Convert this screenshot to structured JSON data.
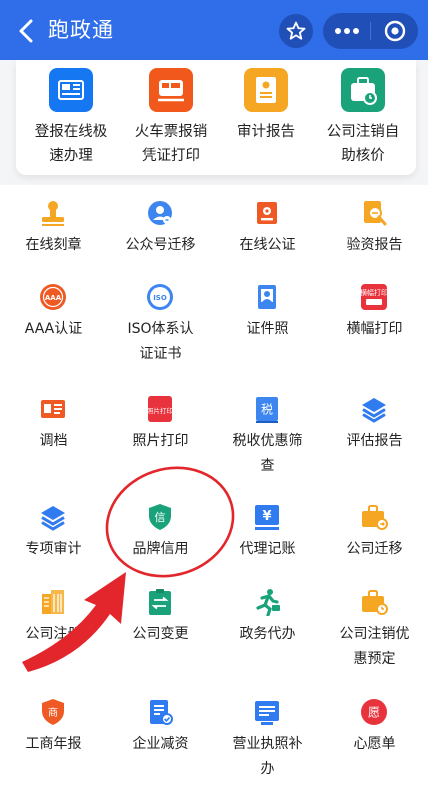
{
  "app": {
    "title": "跑政通"
  },
  "header": {
    "back_glyph": "<",
    "buttons": [
      "star-icon",
      "more-icon",
      "close-target-icon"
    ]
  },
  "hero": [
    {
      "label": "登报在线极速办理",
      "lines": [
        "登报在线极",
        "速办理"
      ],
      "icon": "newspaper-icon",
      "color": "#1677f2"
    },
    {
      "label": "火车票报销凭证打印",
      "lines": [
        "火车票报销",
        "凭证打印"
      ],
      "icon": "train-icon",
      "color": "#f1581b"
    },
    {
      "label": "审计报告",
      "lines": [
        "审计报告"
      ],
      "icon": "report-icon",
      "color": "#f5a623"
    },
    {
      "label": "公司注销自助核价",
      "lines": [
        "公司注销自",
        "助核价"
      ],
      "icon": "briefcase-icon",
      "color": "#1aa37a"
    }
  ],
  "grid": [
    {
      "lines": [
        "在线刻章"
      ],
      "icon": "stamp-icon",
      "color": "#f5a623"
    },
    {
      "lines": [
        "公众号迁移"
      ],
      "icon": "person-circle-icon",
      "color": "#3d86f0"
    },
    {
      "lines": [
        "在线公证"
      ],
      "icon": "notary-icon",
      "color": "#ef5a24"
    },
    {
      "lines": [
        "验资报告"
      ],
      "icon": "search-doc-icon",
      "color": "#f5a623"
    },
    {
      "lines": [
        "AAA认证"
      ],
      "icon": "aaa-badge-icon",
      "color": "#ef5a24"
    },
    {
      "lines": [
        "ISO体系认",
        "证证书"
      ],
      "icon": "iso-badge-icon",
      "color": "#3d86f0"
    },
    {
      "lines": [
        "证件照"
      ],
      "icon": "id-photo-icon",
      "color": "#3d86f0"
    },
    {
      "lines": [
        "横幅打印"
      ],
      "icon": "banner-icon",
      "color": "#e8323c"
    },
    {
      "lines": [
        "调档"
      ],
      "icon": "id-card-icon",
      "color": "#ef5a24"
    },
    {
      "lines": [
        "照片打印"
      ],
      "icon": "photo-print-icon",
      "color": "#e8323c"
    },
    {
      "lines": [
        "税收优惠筛",
        "查"
      ],
      "icon": "tax-icon",
      "color": "#3d86f0"
    },
    {
      "lines": [
        "评估报告"
      ],
      "icon": "layers-icon",
      "color": "#2f7bef"
    },
    {
      "lines": [
        "专项审计"
      ],
      "icon": "layers-icon",
      "color": "#2f7bef"
    },
    {
      "lines": [
        "品牌信用"
      ],
      "icon": "shield-icon",
      "color": "#1aa37a"
    },
    {
      "lines": [
        "代理记账"
      ],
      "icon": "yen-icon",
      "color": "#2f7bef"
    },
    {
      "lines": [
        "公司迁移"
      ],
      "icon": "briefcase-move-icon",
      "color": "#f5a623"
    },
    {
      "lines": [
        "公司注册"
      ],
      "icon": "building-icon",
      "color": "#f5a623"
    },
    {
      "lines": [
        "公司变更"
      ],
      "icon": "clipboard-swap-icon",
      "color": "#1aa37a"
    },
    {
      "lines": [
        "政务代办"
      ],
      "icon": "runner-icon",
      "color": "#1aa37a"
    },
    {
      "lines": [
        "公司注销优",
        "惠预定"
      ],
      "icon": "briefcase-icon",
      "color": "#f5a623"
    },
    {
      "lines": [
        "工商年报"
      ],
      "icon": "shop-badge-icon",
      "color": "#ef5a24"
    },
    {
      "lines": [
        "企业减资"
      ],
      "icon": "doc-check-icon",
      "color": "#2f7bef"
    },
    {
      "lines": [
        "营业执照补",
        "办"
      ],
      "icon": "license-icon",
      "color": "#2f7bef"
    },
    {
      "lines": [
        "心愿单"
      ],
      "icon": "wish-icon",
      "color": "#e8323c"
    }
  ],
  "badges": {
    "aaa": "AAA",
    "iso": "ISO",
    "photo": "照片打印",
    "banner": "横幅打印",
    "tax": "税",
    "credit": "信",
    "yen": "¥",
    "shop": "商",
    "wish": "愿"
  },
  "annotation": {
    "marks": [
      "circle-mark",
      "arrow-mark"
    ],
    "color": "#e3262b"
  }
}
